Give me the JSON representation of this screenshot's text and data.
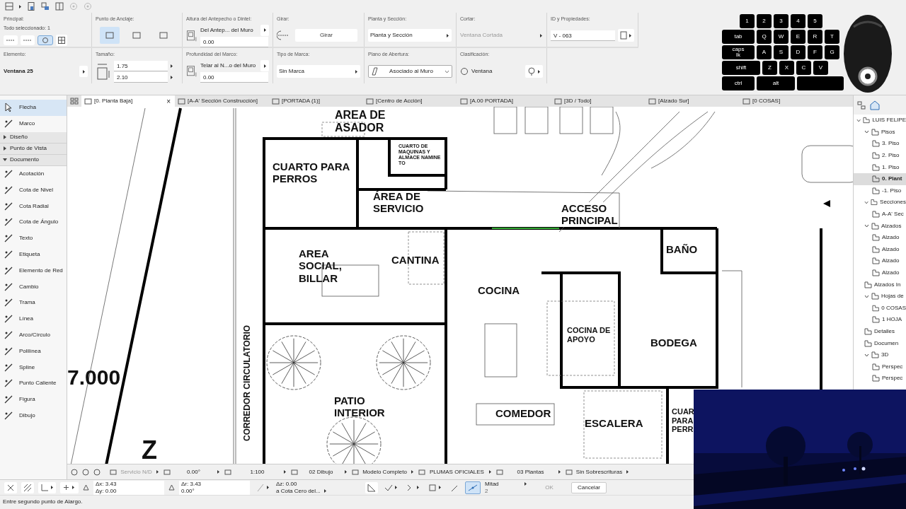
{
  "info_box": {
    "rows": [
      [
        {
          "kind": "principal",
          "label": "Principal:",
          "note": "Todo seleccionado: 1",
          "toggles": [
            {
              "on": false
            },
            {
              "on": false
            },
            {
              "on": true
            }
          ]
        },
        {
          "kind": "anchor",
          "label": "Punto de Anclaje:",
          "options": [
            {
              "selected": true
            },
            {
              "selected": false
            },
            {
              "selected": false
            }
          ]
        },
        {
          "kind": "value_field",
          "label": "Altura del Antepecho o Dintel:",
          "value": "Del Antep... del Muro",
          "field": "0.00"
        },
        {
          "kind": "button",
          "label": "Girar:",
          "button": "Girar"
        },
        {
          "kind": "select",
          "label": "Planta y Sección:",
          "value": "Planta y Sección"
        },
        {
          "kind": "text",
          "label": "Cortar:",
          "value": "Ventana Cortada",
          "disabled": true
        },
        {
          "kind": "field",
          "label": "ID y Propiedades:",
          "field": "V - 063"
        }
      ],
      [
        {
          "kind": "element",
          "label": "Elemento:",
          "value": "Ventana 25"
        },
        {
          "kind": "fields",
          "label": "Tamaño:",
          "fields": [
            "1.75",
            "2.10"
          ]
        },
        {
          "kind": "value_field",
          "label": "Profundidad del Marco:",
          "value": "Telar al N...o del Muro",
          "field": "0.00"
        },
        {
          "kind": "select",
          "label": "Tipo de Marca:",
          "value": "Sin Marca"
        },
        {
          "kind": "dropdown",
          "label": "Plano de Abertura:",
          "value": "Asociado al Muro"
        },
        {
          "kind": "class",
          "label": "Clasificación:",
          "value": "Ventana"
        }
      ]
    ]
  },
  "toolbox": [
    {
      "kind": "tool",
      "label": "Flecha",
      "selected": true
    },
    {
      "kind": "tool",
      "label": "Marco",
      "selected": false
    },
    {
      "kind": "section",
      "label": "Diseño",
      "expanded": false
    },
    {
      "kind": "section",
      "label": "Punto de Vista",
      "expanded": false
    },
    {
      "kind": "section",
      "label": "Documento",
      "expanded": true
    },
    {
      "kind": "tool",
      "label": "Acotación",
      "selected": false
    },
    {
      "kind": "tool",
      "label": "Cota de Nivel",
      "selected": false
    },
    {
      "kind": "tool",
      "label": "Cota Radial",
      "selected": false
    },
    {
      "kind": "tool",
      "label": "Cota de Ángulo",
      "selected": false
    },
    {
      "kind": "tool",
      "label": "Texto",
      "selected": false
    },
    {
      "kind": "tool",
      "label": "Etiqueta",
      "selected": false
    },
    {
      "kind": "tool",
      "label": "Elemento de Red",
      "selected": false
    },
    {
      "kind": "tool",
      "label": "Cambio",
      "selected": false
    },
    {
      "kind": "tool",
      "label": "Trama",
      "selected": false
    },
    {
      "kind": "tool",
      "label": "Línea",
      "selected": false
    },
    {
      "kind": "tool",
      "label": "Arco/Círculo",
      "selected": false
    },
    {
      "kind": "tool",
      "label": "Polilínea",
      "selected": false
    },
    {
      "kind": "tool",
      "label": "Spline",
      "selected": false
    },
    {
      "kind": "tool",
      "label": "Punto Caliente",
      "selected": false
    },
    {
      "kind": "tool",
      "label": "Figura",
      "selected": false
    },
    {
      "kind": "tool",
      "label": "Dibujo",
      "selected": false
    }
  ],
  "tabs": [
    {
      "label": "[0. Planta Baja]",
      "selected": true,
      "close": "×"
    },
    {
      "label": "[A-A' Sección Construcción]",
      "selected": false
    },
    {
      "label": "[PORTADA (1)]",
      "selected": false
    },
    {
      "label": "[Centro de Acción]",
      "selected": false
    },
    {
      "label": "[A.00 PORTADA]",
      "selected": false
    },
    {
      "label": "[3D / Todo]",
      "selected": false
    },
    {
      "label": "[Alzado Sur]",
      "selected": false
    },
    {
      "label": "[0 COSAS]",
      "selected": false
    }
  ],
  "plan_labels": [
    {
      "lines": [
        "AREA DE",
        "ASADOR"
      ]
    },
    {
      "lines": [
        "CUARTO DE",
        "MAQUINAS Y",
        "ALMACE NAMINE",
        "TO"
      ]
    },
    {
      "lines": [
        "CUARTO PARA",
        "PERROS"
      ]
    },
    {
      "lines": [
        "ÁREA DE",
        "SERVICIO"
      ]
    },
    {
      "lines": [
        "ACCESO",
        "PRINCIPAL"
      ]
    },
    {
      "lines": [
        "AREA",
        "SOCIAL,",
        "BILLAR"
      ]
    },
    {
      "lines": [
        "CANTINA"
      ]
    },
    {
      "lines": [
        "BAÑO"
      ]
    },
    {
      "lines": [
        "COCINA"
      ]
    },
    {
      "lines": [
        "COCINA DE",
        "APOYO"
      ]
    },
    {
      "lines": [
        "BODEGA"
      ]
    },
    {
      "lines": [
        "PATIO",
        "INTERIOR"
      ]
    },
    {
      "lines": [
        "COMEDOR"
      ]
    },
    {
      "lines": [
        "ESCALERA"
      ]
    },
    {
      "lines": [
        "CUAR",
        "PARA",
        "PERR"
      ]
    },
    {
      "lines": [
        "CORREDOR CIRCULATORIO"
      ]
    },
    {
      "lines": [
        "7.000"
      ]
    },
    {
      "lines": [
        "Z"
      ]
    }
  ],
  "navigator": [
    {
      "label": "LUIS FELIPE",
      "selected": false,
      "expanded": true,
      "children": [
        {
          "label": "Pisos",
          "selected": false,
          "expanded": true,
          "children": [
            {
              "label": "3. Piso",
              "selected": false
            },
            {
              "label": "2. Piso",
              "selected": false
            },
            {
              "label": "1. Piso",
              "selected": false
            },
            {
              "label": "0. Plant",
              "selected": true
            },
            {
              "label": "-1. Piso",
              "selected": false
            }
          ]
        },
        {
          "label": "Secciones",
          "selected": false,
          "expanded": true,
          "children": [
            {
              "label": "A-A' Sec",
              "selected": false
            }
          ]
        },
        {
          "label": "Alzados",
          "selected": false,
          "expanded": true,
          "children": [
            {
              "label": "Alzado",
              "selected": false
            },
            {
              "label": "Alzado",
              "selected": false
            },
            {
              "label": "Alzado",
              "selected": false
            },
            {
              "label": "Alzado",
              "selected": false
            }
          ]
        },
        {
          "label": "Alzados In",
          "selected": false
        },
        {
          "label": "Hojas de",
          "selected": false,
          "expanded": true,
          "children": [
            {
              "label": "0 COSAS",
              "selected": false
            },
            {
              "label": "1 HOJA",
              "selected": false
            }
          ]
        },
        {
          "label": "Detalles",
          "selected": false
        },
        {
          "label": "Documen",
          "selected": false
        },
        {
          "label": "3D",
          "selected": false,
          "expanded": true,
          "children": [
            {
              "label": "Perspec",
              "selected": false
            },
            {
              "label": "Perspec",
              "selected": false
            }
          ]
        }
      ]
    }
  ],
  "view_bar": [
    "Servicio N/D",
    "0.00°",
    "1:100",
    "02 Dibujo",
    "Modelo Completo",
    "PLUMAS OFICIALES",
    "03 Plantas",
    "Sin Sobrescrituras"
  ],
  "tracker": {
    "dx": "Δx: 3.43",
    "dy": "Δy: 0.00",
    "dr": "Δr: 3.43",
    "angle": "0.00°",
    "dz": "Δz: 0.00",
    "reference": "a Cota Cero del...",
    "snap": "Mitad",
    "snap_count": "2",
    "ok": "OK",
    "ok_disabled": true,
    "cancel": "Cancelar"
  },
  "status_bar": "Entre segundo punto de Alargo.",
  "keyboard": [
    [
      "1",
      "2",
      "3",
      "4",
      "5"
    ],
    [
      "tab",
      "Q",
      "W",
      "E",
      "R",
      "T"
    ],
    [
      "caps lk",
      "A",
      "S",
      "D",
      "F",
      "G"
    ],
    [
      "shift",
      "Z",
      "X",
      "C",
      "V"
    ],
    [
      "ctrl",
      "alt"
    ]
  ]
}
